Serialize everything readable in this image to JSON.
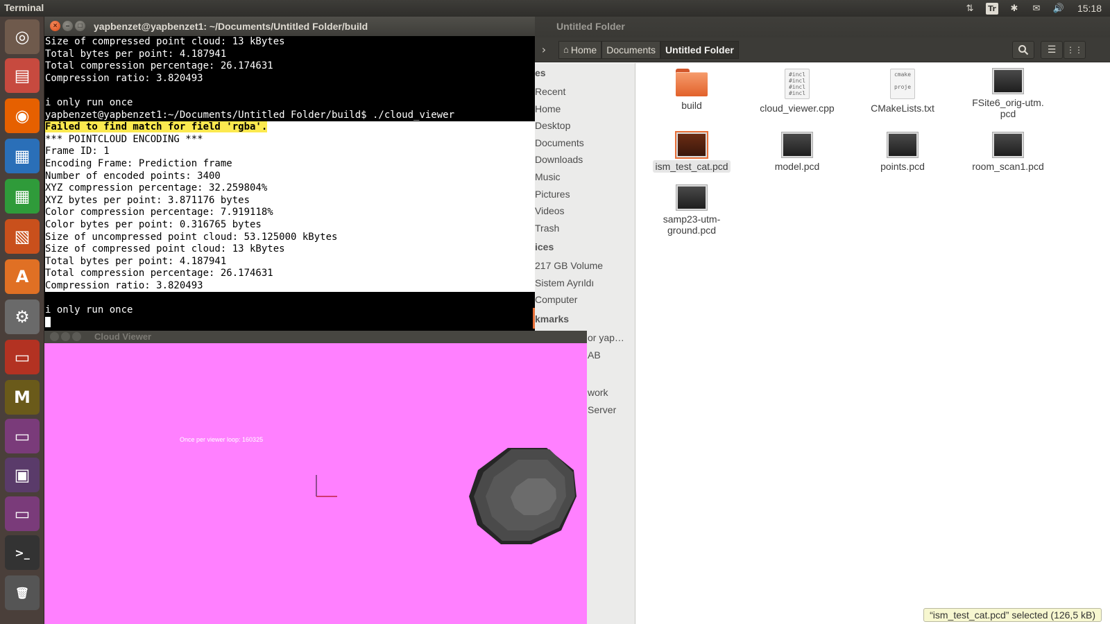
{
  "top_panel": {
    "app_title": "Terminal",
    "indicators": [
      {
        "icon": "network-arrows-icon",
        "glyph": "⇅"
      },
      {
        "icon": "keyboard-layout-icon",
        "glyph": "Tr"
      },
      {
        "icon": "bluetooth-icon",
        "glyph": "✱"
      },
      {
        "icon": "mail-icon",
        "glyph": "✉"
      },
      {
        "icon": "volume-icon",
        "glyph": "🔊"
      }
    ],
    "clock": "15:18"
  },
  "launcher": {
    "items": [
      {
        "name": "ubuntu-dash",
        "glyph": "◎",
        "bg": "#6f5a4c"
      },
      {
        "name": "files",
        "glyph": "▤",
        "bg": "#c74a3f"
      },
      {
        "name": "firefox",
        "glyph": "◉",
        "bg": "#e66000"
      },
      {
        "name": "libreoffice-writer",
        "glyph": "▦",
        "bg": "#2a6fb8"
      },
      {
        "name": "libreoffice-calc",
        "glyph": "▦",
        "bg": "#2f9b3a"
      },
      {
        "name": "libreoffice-impress",
        "glyph": "▧",
        "bg": "#c9501c"
      },
      {
        "name": "software-center",
        "glyph": "A",
        "bg": "#e07024"
      },
      {
        "name": "system-settings",
        "glyph": "⚙",
        "bg": "#6a6a6a"
      },
      {
        "name": "app-red",
        "glyph": "▭",
        "bg": "#b33222"
      },
      {
        "name": "app-mega",
        "glyph": "M",
        "bg": "#6a5a1a"
      },
      {
        "name": "workspace-1",
        "glyph": "▭",
        "bg": "#7a3b7a"
      },
      {
        "name": "workspace-switcher",
        "glyph": "▣",
        "bg": "#5a3b6a"
      },
      {
        "name": "workspace-2",
        "glyph": "▭",
        "bg": "#7a3b7a"
      },
      {
        "name": "terminal",
        "glyph": ">_",
        "bg": "#333333"
      },
      {
        "name": "trash",
        "glyph": "🗑",
        "bg": "#555555"
      }
    ]
  },
  "terminal": {
    "title": "yapbenzet@yapbenzet1: ~/Documents/Untitled Folder/build",
    "lines_top": [
      "Size of compressed point cloud: 13 kBytes",
      "Total bytes per point: 4.187941",
      "Total compression percentage: 26.174631",
      "Compression ratio: 3.820493",
      "",
      "i only run once",
      "yapbenzet@yapbenzet1:~/Documents/Untitled Folder/build$ ./cloud_viewer"
    ],
    "warning_line": "Failed to find match for field 'rgba'.",
    "lines_selected": [
      "*** POINTCLOUD ENCODING ***",
      "Frame ID: 1",
      "Encoding Frame: Prediction frame",
      "Number of encoded points: 3400",
      "XYZ compression percentage: 32.259804%",
      "XYZ bytes per point: 3.871176 bytes",
      "Color compression percentage: 7.919118%",
      "Color bytes per point: 0.316765 bytes",
      "Size of uncompressed point cloud: 53.125000 kBytes",
      "Size of compressed point cloud: 13 kBytes",
      "Total bytes per point: 4.187941",
      "Total compression percentage: 26.174631",
      "Compression ratio: 3.820493"
    ],
    "lines_bottom": [
      "",
      "i only run once"
    ]
  },
  "viewer": {
    "title": "Cloud Viewer",
    "overlay_text": "Once per viewer loop: 160325",
    "background_color": "#ff80ff"
  },
  "nautilus": {
    "title": "Untitled Folder",
    "breadcrumbs": [
      {
        "label": "Home",
        "icon": "home-icon"
      },
      {
        "label": "Documents"
      },
      {
        "label": "Untitled Folder",
        "active": true
      }
    ],
    "sidebar": {
      "places_header": "es",
      "places": [
        "Recent",
        "Home",
        "Desktop",
        "Documents",
        "Downloads",
        "Music",
        "Pictures",
        "Videos",
        "Trash"
      ],
      "devices_header": "ices",
      "devices": [
        "217 GB Volume",
        "Sistem Ayrıldı",
        "Computer"
      ],
      "bookmarks_header": "kmarks",
      "bookmarks": [
        "or yap…",
        "AB"
      ],
      "network": [
        "work",
        "Server"
      ]
    },
    "files": [
      {
        "name": "build",
        "type": "folder"
      },
      {
        "name": "cloud_viewer.cpp",
        "type": "code",
        "preview": [
          "#incl",
          "#incl",
          "#incl",
          "#incl"
        ]
      },
      {
        "name": "CMakeLists.txt",
        "type": "text",
        "preview": [
          "cmake",
          "",
          "proje"
        ]
      },
      {
        "name": "FSite6_orig-utm.\npcd",
        "type": "pcd"
      },
      {
        "name": "ism_test_cat.pcd",
        "type": "pcd",
        "selected": true
      },
      {
        "name": "model.pcd",
        "type": "pcd"
      },
      {
        "name": "points.pcd",
        "type": "pcd"
      },
      {
        "name": "room_scan1.pcd",
        "type": "pcd"
      },
      {
        "name": "samp23-utm-\nground.pcd",
        "type": "pcd"
      }
    ],
    "status": "“ism_test_cat.pcd” selected  (126,5 kB)"
  }
}
